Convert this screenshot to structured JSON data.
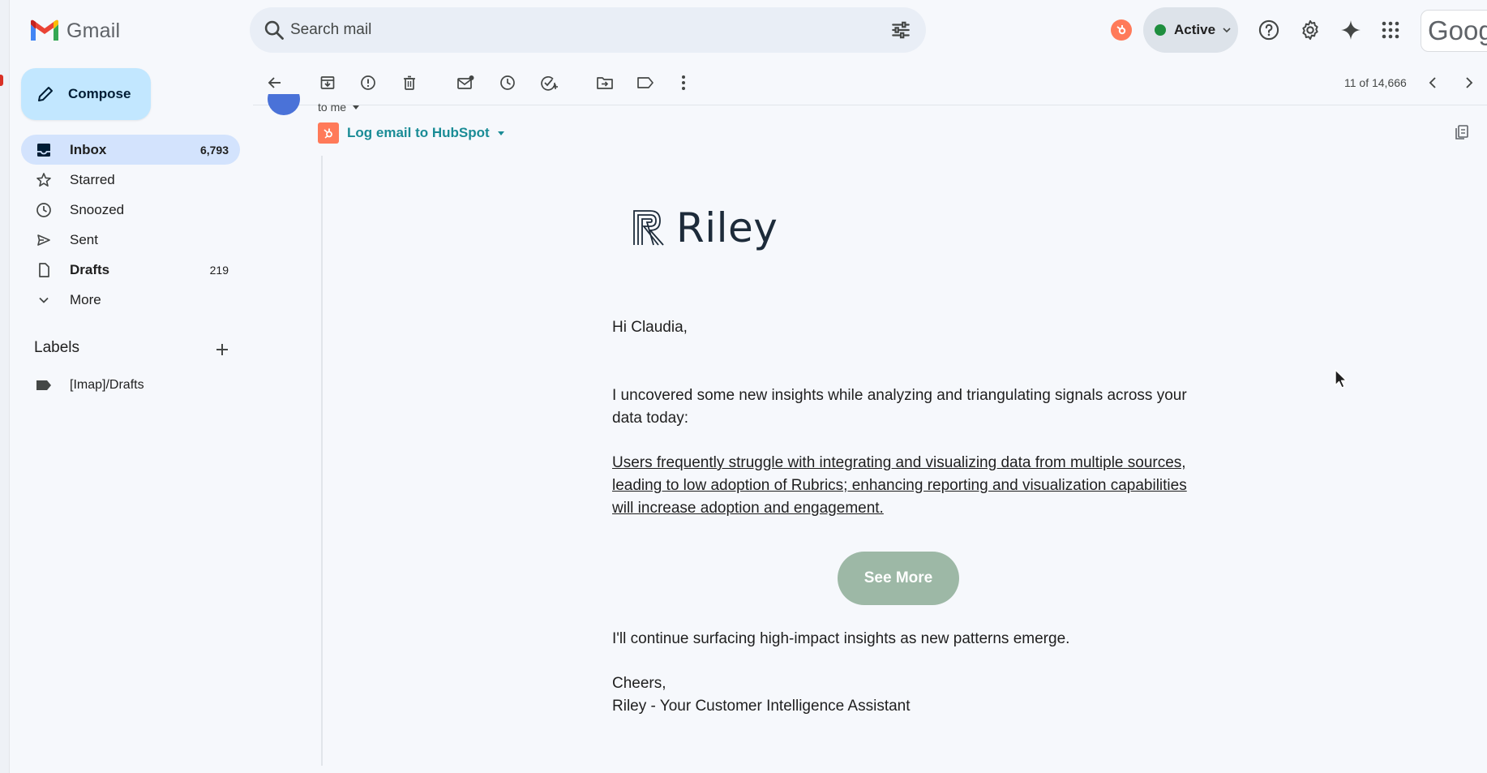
{
  "app": {
    "name": "Gmail"
  },
  "search": {
    "placeholder": "Search mail"
  },
  "header": {
    "status_label": "Active",
    "google_partial": "Googl"
  },
  "compose": {
    "label": "Compose"
  },
  "nav": {
    "items": [
      {
        "label": "Inbox",
        "count": "6,793",
        "icon": "inbox-icon"
      },
      {
        "label": "Starred",
        "count": "",
        "icon": "star-icon"
      },
      {
        "label": "Snoozed",
        "count": "",
        "icon": "clock-icon"
      },
      {
        "label": "Sent",
        "count": "",
        "icon": "send-icon"
      },
      {
        "label": "Drafts",
        "count": "219",
        "icon": "draft-icon"
      },
      {
        "label": "More",
        "count": "",
        "icon": "chevron-down-icon"
      }
    ]
  },
  "labels": {
    "heading": "Labels",
    "items": [
      {
        "label": "[Imap]/Drafts"
      }
    ]
  },
  "toolbar": {
    "pager_text": "11 of 14,666"
  },
  "message": {
    "recipient": "to me",
    "hubspot_action": "Log email to HubSpot",
    "brand_name": "Riley",
    "greeting": "Hi Claudia,",
    "intro": "I uncovered some new insights while analyzing and triangulating signals across your data today:",
    "insight": "Users frequently struggle with integrating and visualizing data from multiple sources, leading to low adoption of Rubrics; enhancing reporting and visualization capabilities will increase adoption and engagement.",
    "cta_label": "See More",
    "closing": "I'll continue surfacing high-impact insights as new patterns emerge.",
    "signoff": "Cheers,",
    "signature": "Riley - Your Customer Intelligence Assistant"
  },
  "colors": {
    "background": "#f6f8fc",
    "compose_bg": "#c2e7ff",
    "active_nav_bg": "#d3e3fd",
    "hubspot_orange": "#ff7a59",
    "hubspot_link": "#1a8c96",
    "cta_bg": "#9db8a6",
    "status_green": "#1e8e3e"
  }
}
